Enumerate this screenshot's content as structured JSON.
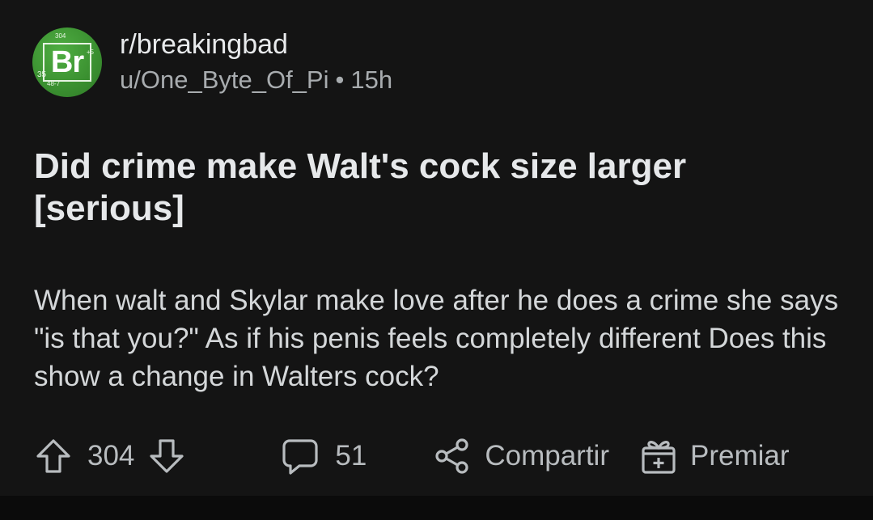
{
  "post": {
    "subreddit": "r/breakingbad",
    "author": "u/One_Byte_Of_Pi",
    "separator": "•",
    "age": "15h",
    "title": "Did crime make Walt's cock size larger [serious]",
    "body": "When walt and Skylar make love after he does a crime she says \"is that you?\" As if his penis feels completely different Does this show a change in Walters cock?",
    "avatar": {
      "symbol": "Br",
      "small_numbers": [
        "304",
        "+5",
        "35",
        "48-7"
      ],
      "color": "#3a8f30"
    }
  },
  "actions": {
    "upvote_icon": "arrow-up-icon",
    "score": "304",
    "downvote_icon": "arrow-down-icon",
    "comment_icon": "speech-bubble-icon",
    "comments": "51",
    "share_icon": "share-icon",
    "share_label": "Compartir",
    "award_icon": "gift-icon",
    "award_label": "Premiar"
  },
  "colors": {
    "background": "#141414",
    "text": "#d7dadc",
    "muted": "#a8acaf"
  }
}
